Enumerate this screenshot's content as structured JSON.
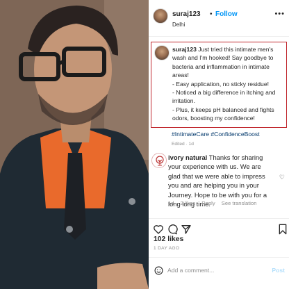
{
  "post": {
    "username": "suraj123",
    "separator": "•",
    "follow_label": "Follow",
    "location": "Delhi",
    "more_label": "•••"
  },
  "caption": {
    "username": "suraj123",
    "intro": "Just tried this intimate men's wash and I'm hooked! Say goodbye to bacteria and inflammation in intimate areas!",
    "points": [
      "- Easy application, no sticky residue!",
      "- Noticed a big difference in itching and irritation.",
      "- Plus, it keeps pH balanced and fights odors, boosting my confidence!"
    ],
    "hashtags": "#IntimateCare #ConfidenceBoost",
    "edited": "Edited · 1d"
  },
  "reply": {
    "username": "ivory natural",
    "text": "Thanks for sharing your experience with us. We are glad that we were able to impress you and are helping you in your Journey. Hope to be with you for a long long time.",
    "time": "1d",
    "likes": "2 likes",
    "reply_label": "Reply",
    "translation_label": "See translation"
  },
  "stats": {
    "likes": "102 likes",
    "posted": "1 DAY AGO"
  },
  "comment_box": {
    "placeholder": "Add a comment...",
    "post_label": "Post"
  },
  "colors": {
    "follow": "#0095f6",
    "highlight_border": "#c0262c",
    "hashtag": "#00376b",
    "muted": "#8e8e8e"
  }
}
